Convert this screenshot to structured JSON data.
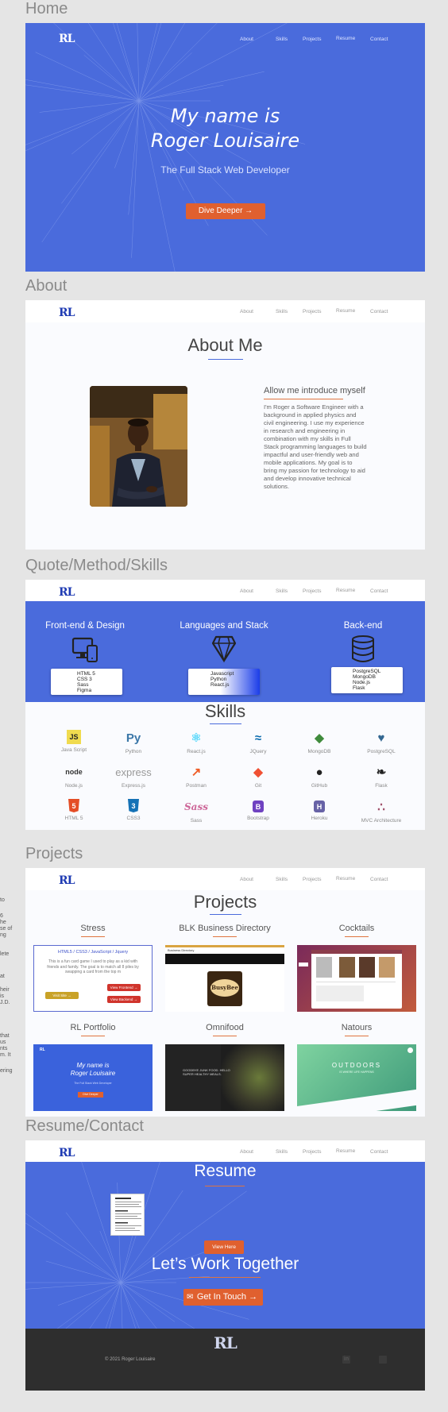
{
  "sections": {
    "home": "Home",
    "about": "About",
    "skills": "Quote/Method/Skills",
    "projects": "Projects",
    "resume": "Resume/Contact"
  },
  "nav": {
    "logo": "RL",
    "links": [
      "About",
      "Skills",
      "Projects",
      "Resume",
      "Contact"
    ]
  },
  "hero": {
    "line1": "My name is",
    "line2": "Roger Louisaire",
    "subtitle": "The Full Stack Web Developer",
    "cta": "Dive Deeper →"
  },
  "about": {
    "title": "About Me",
    "intro": "Allow me introduce myself",
    "bio": "I'm Roger a Software Engineer with a background in applied physics and civil engineering. I use my experience in research and engineering in combination with my skills in Full Stack programming languages to build impactful and user-friendly web and mobile applications. My goal is to bring my passion for technology to aid and develop innovative technical solutions."
  },
  "method": {
    "columns": [
      {
        "title": "Front-end & Design",
        "items": [
          "HTML 5",
          "CSS 3",
          "Sass",
          "Figma"
        ]
      },
      {
        "title": "Languages and Stack",
        "items": [
          "Javascript",
          "Python",
          "React.js"
        ]
      },
      {
        "title": "Back-end",
        "items": [
          "PostgreSQL",
          "MongoDB",
          "Node.js",
          "Flask"
        ]
      }
    ]
  },
  "skills": {
    "title": "Skills",
    "items": [
      {
        "label": "Java Script",
        "icon": "JS",
        "color": "#f0db4f"
      },
      {
        "label": "Python",
        "icon": "Py",
        "color": "#3b77a8"
      },
      {
        "label": "React.js",
        "icon": "⚛",
        "color": "#61dafb"
      },
      {
        "label": "JQuery",
        "icon": "≈",
        "color": "#0769ad"
      },
      {
        "label": "MongoDB",
        "icon": "◆",
        "color": "#3f8b3c"
      },
      {
        "label": "PostgreSQL",
        "icon": "♥",
        "color": "#336791"
      },
      {
        "label": "Node.js",
        "icon": "node",
        "color": "#333333"
      },
      {
        "label": "Express.js",
        "icon": "express",
        "color": "#999999"
      },
      {
        "label": "Postman",
        "icon": "↗",
        "color": "#ef5b25"
      },
      {
        "label": "Git",
        "icon": "◆",
        "color": "#f05033"
      },
      {
        "label": "GitHub",
        "icon": "●",
        "color": "#222222"
      },
      {
        "label": "Flask",
        "icon": "❧",
        "color": "#222222"
      },
      {
        "label": "HTML 5",
        "icon": "5",
        "color": "#e44d26"
      },
      {
        "label": "CSS3",
        "icon": "3",
        "color": "#1572b6"
      },
      {
        "label": "Sass",
        "icon": "Sass",
        "color": "#cd6799"
      },
      {
        "label": "Bootstrap",
        "icon": "B",
        "color": "#6f42c1"
      },
      {
        "label": "Heroku",
        "icon": "H",
        "color": "#6762a6"
      },
      {
        "label": "MVC Architecture",
        "icon": "∴",
        "color": "#a0506a"
      }
    ]
  },
  "projects": {
    "title": "Projects",
    "items": [
      {
        "title": "Stress"
      },
      {
        "title": "BLK Business Directory"
      },
      {
        "title": "Cocktails"
      },
      {
        "title": "RL Portfolio"
      },
      {
        "title": "Omnifood"
      },
      {
        "title": "Natours"
      }
    ],
    "stress_card": {
      "heading": "HTML5 / CSS3 / JavaScript / Jquery",
      "body": "This is a fun card game I used to play as a kid with friends and family. The goal is to match all 8 piles by swapping a card from the top m",
      "btn_site": "Visit Site →",
      "btn_front": "View Frontend →",
      "btn_back": "View Backend →"
    },
    "blk_card": {
      "header": "Business Directory",
      "brand": "BusyBee"
    },
    "portfolio_card": {
      "line1": "My name is",
      "line2": "Roger Louisaire",
      "sub": "The Full Stack Web Developer",
      "btn": "Dive Deeper"
    },
    "omnifood_card": {
      "text": "GOODBYE JUNK FOOD. HELLO SUPER HEALTHY MEALS."
    },
    "natours_card": {
      "text": "OUTDOORS",
      "sub": "IS WHERE LIFE HAPPENS"
    }
  },
  "edge_text": [
    "to",
    "6",
    "he",
    "se of",
    "ng",
    "lete",
    "at",
    "heir",
    "is",
    "J.D.",
    "that",
    "us",
    "nts",
    "m. It",
    "ering"
  ],
  "resume": {
    "title": "Resume",
    "view": "View Here",
    "together": "Let’s Work Together",
    "contact": "Get In Touch →"
  },
  "footer": {
    "logo": "RL",
    "copyright": "© 2021 Roger Louisaire"
  },
  "colors": {
    "blue": "#4a6bdc",
    "orange": "#e0602f",
    "dark": "#2e2e2e"
  }
}
